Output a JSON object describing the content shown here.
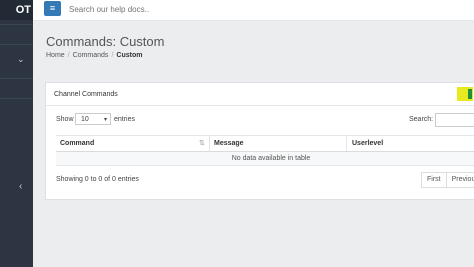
{
  "sidebar": {
    "brand": "OT"
  },
  "topbar": {
    "search_placeholder": "Search our help docs.."
  },
  "page": {
    "title": "Commands: Custom",
    "breadcrumb": [
      "Home",
      "Commands",
      "Custom"
    ]
  },
  "panel": {
    "title": "Channel Commands",
    "show_label": "Show",
    "page_size": "10",
    "entries_label": "entries",
    "search_label": "Search:",
    "columns": [
      "Command",
      "Message",
      "Userlevel"
    ],
    "empty_text": "No data available in table",
    "info_text": "Showing 0 to 0 of 0 entries",
    "pager": [
      "First",
      "Previous"
    ]
  },
  "colors": {
    "sidebar": "#2c3541",
    "accent": "#337ab7",
    "highlight": "#e7ea1f"
  }
}
